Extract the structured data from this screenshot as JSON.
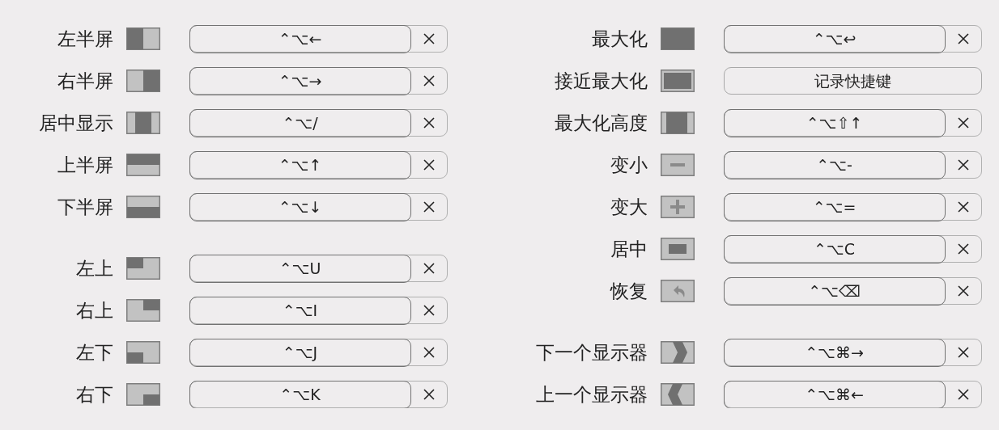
{
  "columns": [
    {
      "groups": [
        [
          {
            "label": "左半屏",
            "kind": "left-half",
            "shortcut": "⌃⌥←"
          },
          {
            "label": "右半屏",
            "kind": "right-half",
            "shortcut": "⌃⌥→"
          },
          {
            "label": "居中显示",
            "kind": "center-third",
            "shortcut": "⌃⌥/"
          },
          {
            "label": "上半屏",
            "kind": "top-half",
            "shortcut": "⌃⌥↑"
          },
          {
            "label": "下半屏",
            "kind": "bottom-half",
            "shortcut": "⌃⌥↓"
          }
        ],
        [
          {
            "label": "左上",
            "kind": "top-left",
            "shortcut": "⌃⌥U"
          },
          {
            "label": "右上",
            "kind": "top-right",
            "shortcut": "⌃⌥I"
          },
          {
            "label": "左下",
            "kind": "bottom-left",
            "shortcut": "⌃⌥J"
          },
          {
            "label": "右下",
            "kind": "bottom-right",
            "shortcut": "⌃⌥K"
          }
        ]
      ]
    },
    {
      "groups": [
        [
          {
            "label": "最大化",
            "kind": "maximize",
            "shortcut": "⌃⌥↩"
          },
          {
            "label": "接近最大化",
            "kind": "almost-maximize",
            "placeholder": "记录快捷键"
          },
          {
            "label": "最大化高度",
            "kind": "maximize-height",
            "shortcut": "⌃⌥⇧↑"
          },
          {
            "label": "变小",
            "kind": "smaller",
            "shortcut": "⌃⌥-"
          },
          {
            "label": "变大",
            "kind": "larger",
            "shortcut": "⌃⌥="
          },
          {
            "label": "居中",
            "kind": "center",
            "shortcut": "⌃⌥C"
          },
          {
            "label": "恢复",
            "kind": "restore",
            "shortcut": "⌃⌥⌫"
          }
        ],
        [
          {
            "label": "下一个显示器",
            "kind": "next-display",
            "shortcut": "⌃⌥⌘→"
          },
          {
            "label": "上一个显示器",
            "kind": "prev-display",
            "shortcut": "⌃⌥⌘←"
          }
        ]
      ]
    }
  ]
}
